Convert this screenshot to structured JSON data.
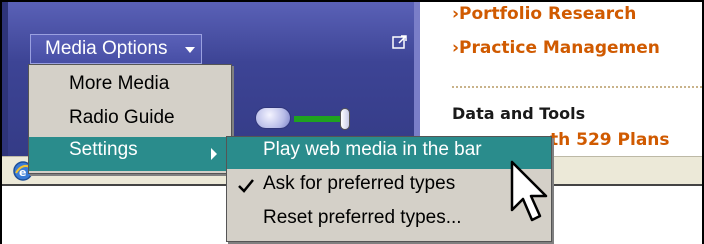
{
  "media_bar": {
    "options_button_label": "Media Options",
    "accent_color": "#3d4495"
  },
  "options_menu": {
    "items": [
      {
        "label": "More Media"
      },
      {
        "label": "Radio Guide"
      },
      {
        "label": "Settings",
        "selected": true,
        "has_submenu": true
      }
    ]
  },
  "settings_submenu": {
    "items": [
      {
        "label": "Play web media in the bar",
        "selected": true
      },
      {
        "label": "Ask for preferred types",
        "checked": true
      },
      {
        "label": "Reset preferred types..."
      }
    ]
  },
  "web_content": {
    "links": [
      {
        "label": "Portfolio Research"
      },
      {
        "label": "Practice Managemen"
      }
    ],
    "section_heading": "Data and Tools",
    "section_link": "th 529 Plans",
    "link_color": "#d05a00"
  },
  "icons": {
    "undock": "undock-icon",
    "audio": "audio-icon",
    "status": "ie-icon",
    "check": "check-icon",
    "cursor": "mouse-cursor-icon"
  },
  "selection_color": "#2a8c8c"
}
